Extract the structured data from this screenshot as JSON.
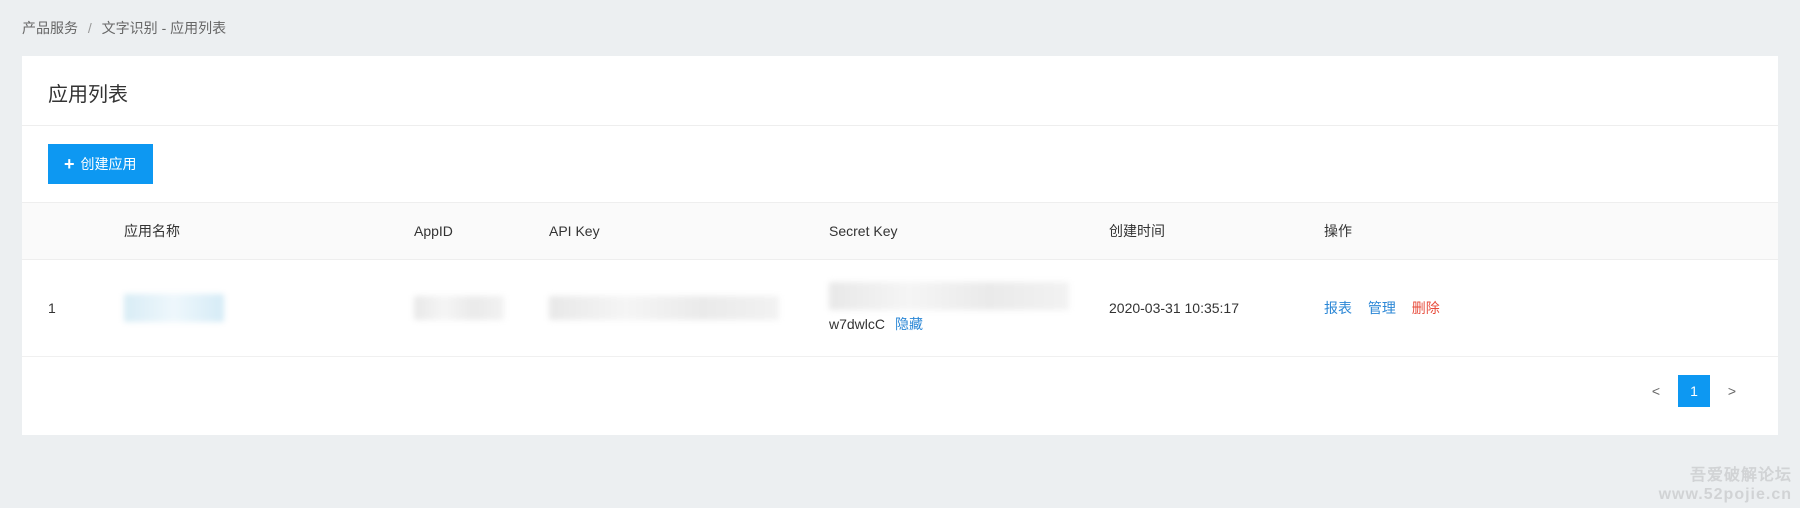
{
  "breadcrumb": {
    "root": "产品服务",
    "sep": "/",
    "section": "文字识别",
    "dash": "-",
    "current": "应用列表"
  },
  "panel": {
    "title": "应用列表"
  },
  "toolbar": {
    "create_label": "创建应用"
  },
  "table": {
    "headers": {
      "idx": "",
      "name": "应用名称",
      "appid": "AppID",
      "apikey": "API Key",
      "secret": "Secret Key",
      "time": "创建时间",
      "ops": "操作"
    },
    "rows": [
      {
        "idx": "1",
        "secret_tail": "w7dwlcC",
        "secret_toggle": "隐藏",
        "time": "2020-03-31 10:35:17",
        "ops": {
          "report": "报表",
          "manage": "管理",
          "delete": "删除"
        }
      }
    ]
  },
  "pagination": {
    "prev": "<",
    "current": "1",
    "next": ">"
  },
  "watermark": {
    "line1": "吾爱破解论坛",
    "line2": "www.52pojie.cn"
  }
}
